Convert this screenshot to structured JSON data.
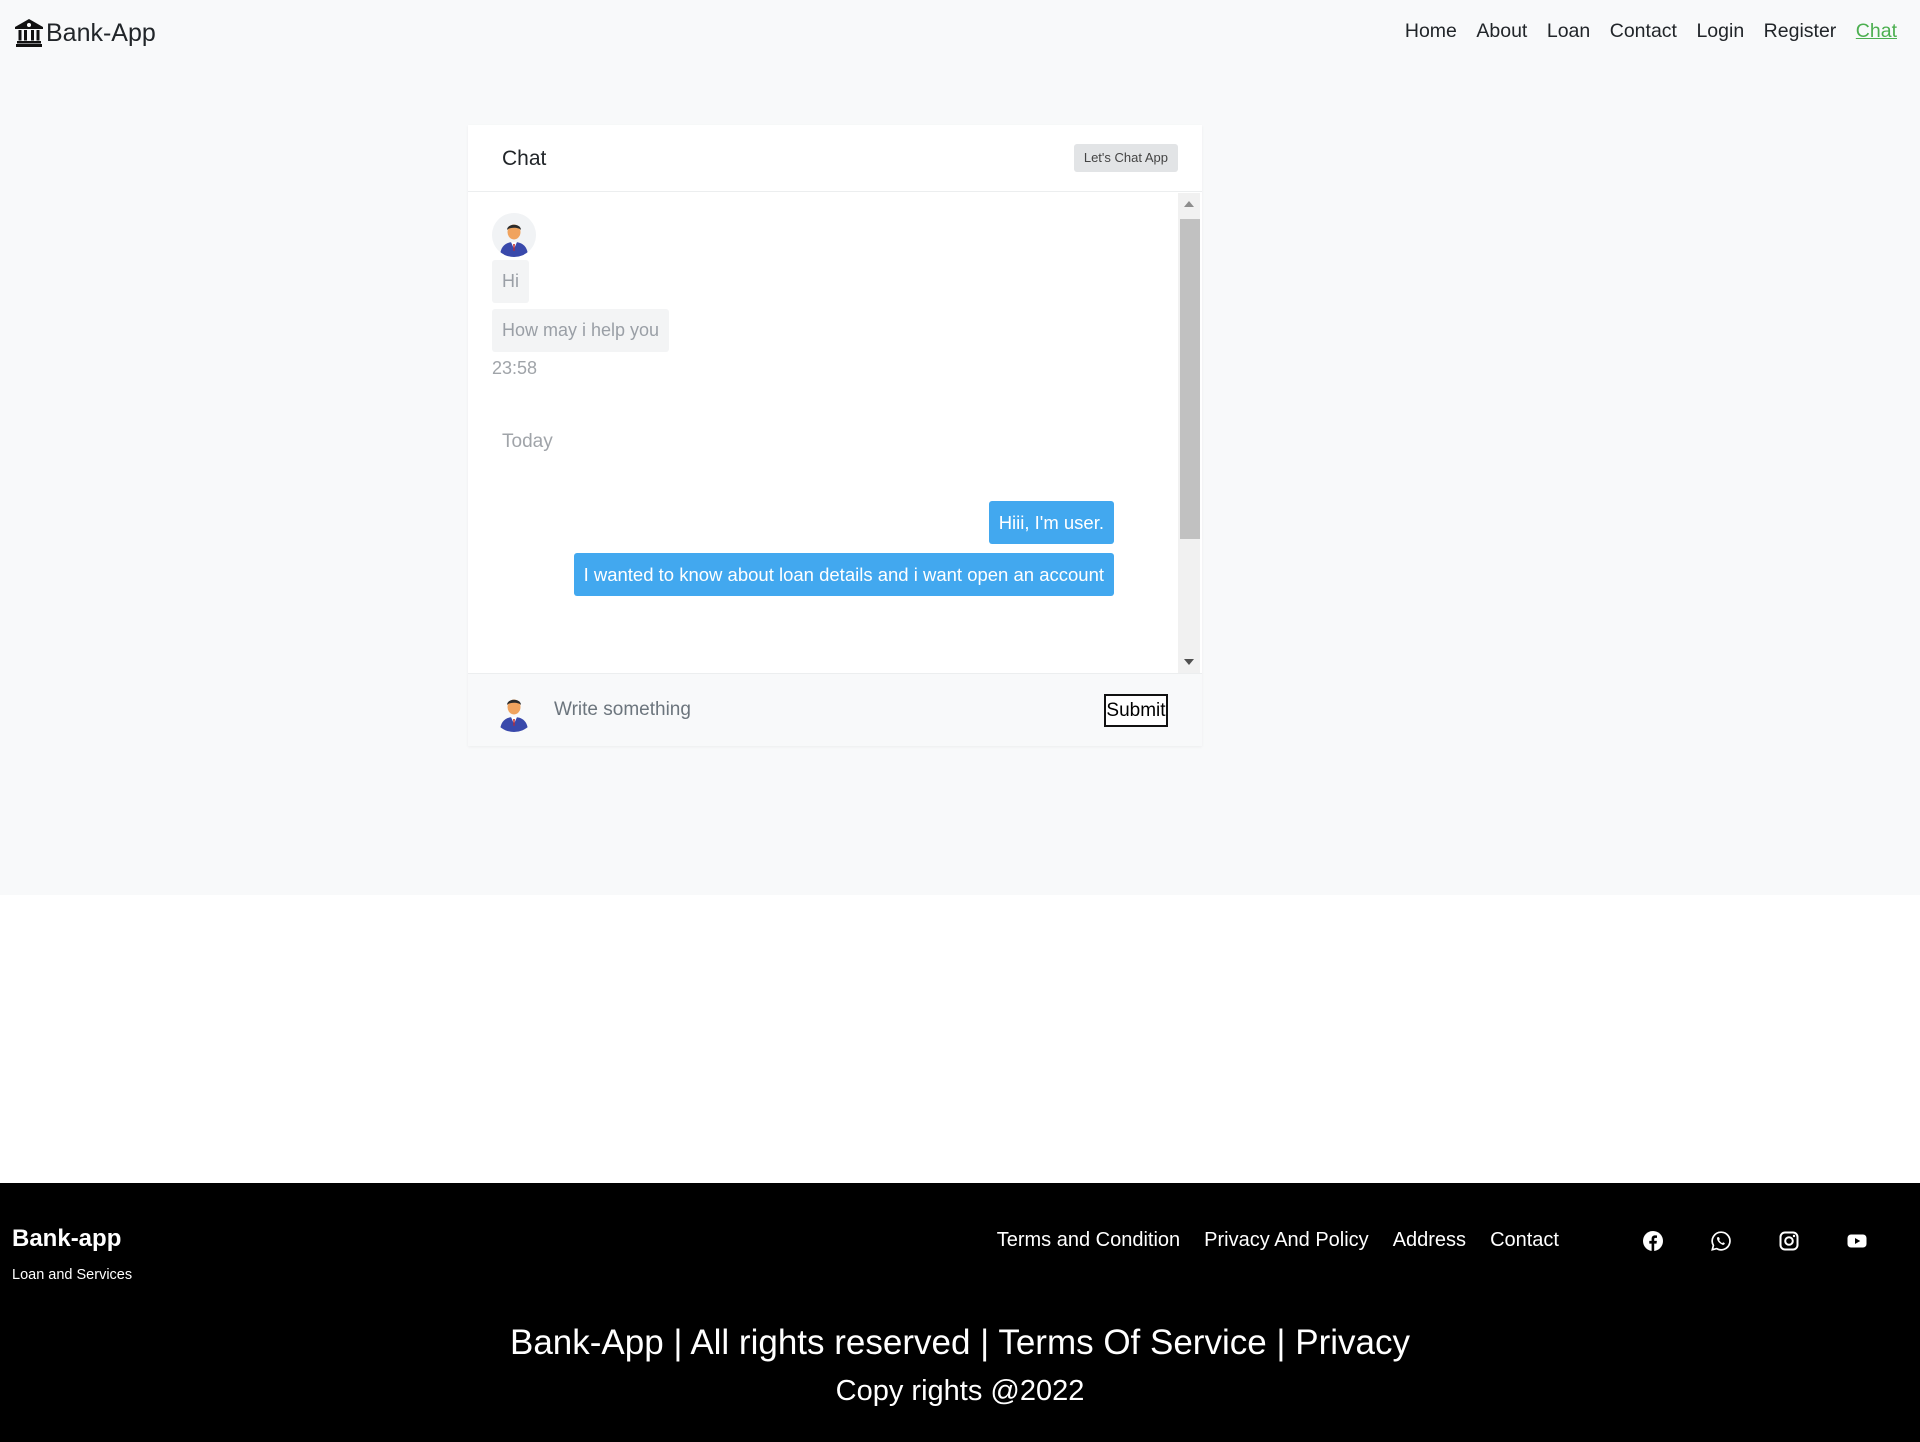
{
  "navbar": {
    "brand": "Bank-App",
    "links": [
      "Home",
      "About",
      "Loan",
      "Contact",
      "Login",
      "Register",
      "Chat"
    ],
    "active_link": "Chat"
  },
  "chat": {
    "title": "Chat",
    "badge": "Let's Chat App",
    "incoming_messages": [
      "Hi",
      "How may i help you"
    ],
    "incoming_time": "23:58",
    "day_separator": "Today",
    "outgoing_messages": [
      "Hiii, I'm user.",
      "I wanted to know about loan details and i want open an account"
    ],
    "input_placeholder": "Write something",
    "submit_label": "Submit"
  },
  "footer": {
    "brand": "Bank-app",
    "tagline": "Loan and Services",
    "links": [
      "Terms and Condition",
      "Privacy And Policy",
      "Address",
      "Contact"
    ],
    "socials": [
      "facebook-icon",
      "whatsapp-icon",
      "instagram-icon",
      "youtube-icon"
    ],
    "rights": "Bank-App | All rights reserved | Terms Of Service | Privacy",
    "copyright": "Copy rights @2022"
  },
  "colors": {
    "active_nav": "#4caf50",
    "outgoing_bubble": "#42a8ef",
    "page_bg": "#f8f9fa",
    "footer_bg": "#000000"
  }
}
